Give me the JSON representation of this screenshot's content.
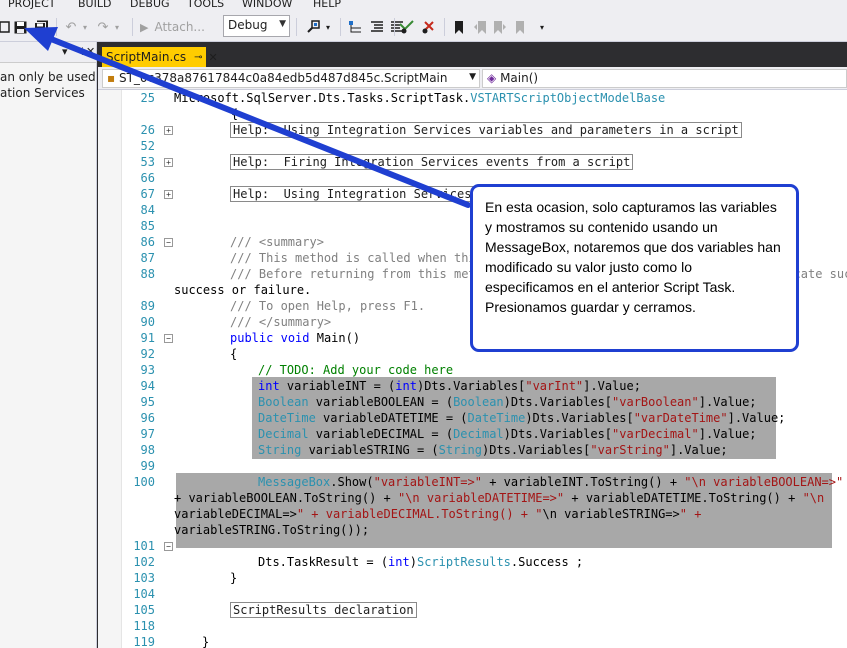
{
  "menu": [
    "PROJECT",
    "BUILD",
    "DEBUG",
    "TOOLS",
    "WINDOW",
    "HELP"
  ],
  "toolbar": {
    "attach_label": "Attach...",
    "config_value": "Debug"
  },
  "left_panel": {
    "line1": "an only be used by",
    "line2": "ation Services"
  },
  "tab": {
    "label": "ScriptMain.cs"
  },
  "nav": {
    "class_value": "ST_0c378a87617844c0a84edb5d487d845c.ScriptMain",
    "method_value": "Main()"
  },
  "code_lines": [
    {
      "n": "25",
      "text": "Microsoft.SqlServer.Dts.Tasks.ScriptTask.",
      "type_part": "VSTARTScriptObjectModelBase"
    },
    {
      "n": "",
      "text": "    {"
    },
    {
      "n": "26",
      "region": "Help:  Using Integration Services variables and parameters in a script"
    },
    {
      "n": "52",
      "text": ""
    },
    {
      "n": "53",
      "region": "Help:  Firing Integration Services events from a script"
    },
    {
      "n": "66",
      "text": ""
    },
    {
      "n": "67",
      "region": "Help:  Using Integration Services Connection Managers in a script"
    },
    {
      "n": "84",
      "text": ""
    },
    {
      "n": "85",
      "text": ""
    },
    {
      "n": "86",
      "doc": "/// <summary>"
    },
    {
      "n": "87",
      "doc": "/// This method is called when this script task executes in the control flow."
    },
    {
      "n": "88",
      "doc": "/// Before returning from this method, set the value of Dts.TaskResult to indicate success or failure."
    },
    {
      "n": "",
      "text": "success or failure."
    },
    {
      "n": "89",
      "doc": "/// To open Help, press F1."
    },
    {
      "n": "90",
      "doc": "/// </summary>"
    },
    {
      "n": "91",
      "text": "public void Main()"
    },
    {
      "n": "92",
      "text": "{"
    },
    {
      "n": "93",
      "comment": "// TODO: Add your code here"
    },
    {
      "n": "94",
      "text": "int variableINT = (int)Dts.Variables[\"varInt\"].Value;"
    },
    {
      "n": "95",
      "text": "Boolean variableBOOLEAN = (Boolean)Dts.Variables[\"varBoolean\"].Value;"
    },
    {
      "n": "96",
      "text": "DateTime variableDATETIME = (DateTime)Dts.Variables[\"varDateTime\"].Value;"
    },
    {
      "n": "97",
      "text": "Decimal variableDECIMAL = (Decimal)Dts.Variables[\"varDecimal\"].Value;"
    },
    {
      "n": "98",
      "text": "String variableSTRING = (String)Dts.Variables[\"varString\"].Value;"
    },
    {
      "n": "99",
      "text": ""
    },
    {
      "n": "100",
      "text": "MessageBox.Show(\"variableINT=>\" + variableINT.ToString() + \"\\n variableBOOLEAN=>\""
    },
    {
      "n": "",
      "text": "+ variableBOOLEAN.ToString() + \"\\n variableDATETIME=>\" + variableDATETIME.ToString() + \"\\n"
    },
    {
      "n": "",
      "text": "variableDECIMAL=>\" + variableDECIMAL.ToString() + \"\\n variableSTRING=>\" +"
    },
    {
      "n": "",
      "text": "variableSTRING.ToString());"
    },
    {
      "n": "101",
      "text": ""
    },
    {
      "n": "102",
      "text": "Dts.TaskResult = (int)ScriptResults.Success ;"
    },
    {
      "n": "103",
      "text": "}"
    },
    {
      "n": "104",
      "text": ""
    },
    {
      "n": "105",
      "region": "ScriptResults declaration"
    },
    {
      "n": "118",
      "text": ""
    },
    {
      "n": "119",
      "text": "}"
    }
  ],
  "line_numbers": [
    "25",
    "26",
    "52",
    "53",
    "66",
    "67",
    "84",
    "85",
    "86",
    "87",
    "88",
    "89",
    "90",
    "91",
    "92",
    "93",
    "94",
    "95",
    "96",
    "97",
    "98",
    "99",
    "100",
    "101",
    "102",
    "103",
    "104",
    "105",
    "118",
    "119"
  ],
  "callout": {
    "text": "En esta ocasion, solo capturamos las variables y mostramos su contenido usando un MessageBox, notaremos que dos variables han modificado su valor justo como lo especificamos en el anterior Script Task. Presionamos guardar y cerramos."
  },
  "colors": {
    "callout_border": "#1f3fd1",
    "arrow": "#1f3fd1",
    "tab_active": "#ffcc00",
    "selection": "#a8a8a8"
  }
}
